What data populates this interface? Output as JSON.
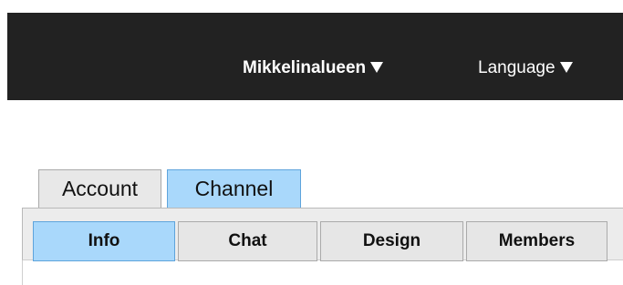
{
  "header": {
    "account_menu_label": "Mikkelinalueen",
    "language_menu_label": "Language"
  },
  "main_tabs": [
    {
      "label": "Account",
      "active": false
    },
    {
      "label": "Channel",
      "active": true
    }
  ],
  "sub_tabs": [
    {
      "label": "Info",
      "active": true
    },
    {
      "label": "Chat",
      "active": false
    },
    {
      "label": "Design",
      "active": false
    },
    {
      "label": "Members",
      "active": false
    }
  ],
  "colors": {
    "topbar_bg": "#222222",
    "active_tab_bg": "#a9d8fb",
    "active_tab_border": "#5ea4dc",
    "inactive_tab_bg": "#e8e8e8"
  },
  "icons": {
    "dropdown": "caret-down-icon"
  }
}
